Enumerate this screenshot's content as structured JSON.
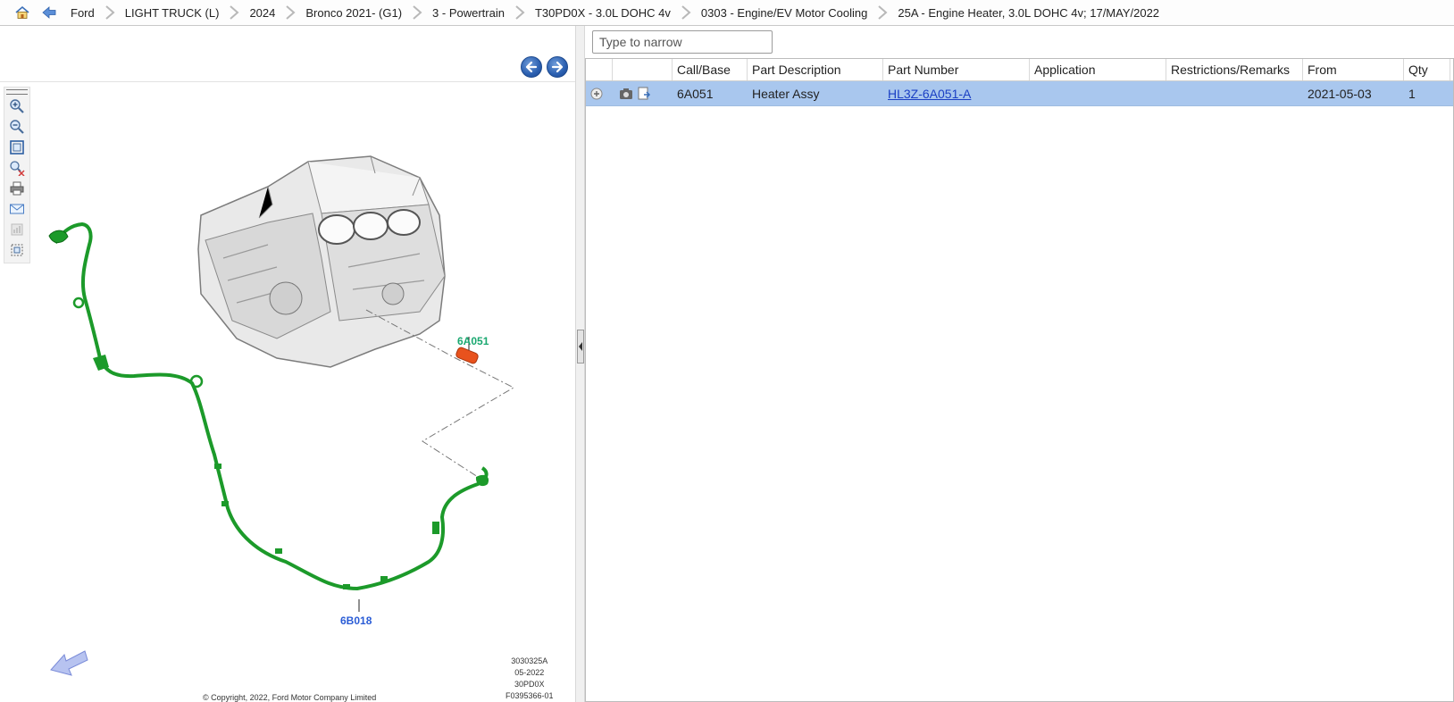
{
  "breadcrumb": [
    "Ford",
    "LIGHT TRUCK (L)",
    "2024",
    "Bronco 2021- (G1)",
    "3 - Powertrain",
    "T30PD0X - 3.0L DOHC 4v",
    "0303 - Engine/EV Motor Cooling",
    "25A - Engine Heater, 3.0L DOHC 4v; 17/MAY/2022"
  ],
  "icons": {
    "home": "home-icon",
    "back": "back-arrow-icon",
    "prev": "previous-arrow-icon",
    "next": "next-arrow-icon",
    "tools": [
      "zoom-in-icon",
      "zoom-out-icon",
      "fit-to-window-icon",
      "clear-zoom-icon",
      "print-icon",
      "email-icon",
      "export-icon",
      "select-region-icon"
    ]
  },
  "diagram": {
    "callouts": [
      "6A051",
      "6B018"
    ],
    "stamp": [
      "3030325A",
      "05-2022",
      "30PD0X",
      "F0395366-01"
    ],
    "copyright": "© Copyright, 2022, Ford Motor Company Limited"
  },
  "filter": {
    "placeholder": "Type to narrow",
    "value": ""
  },
  "grid": {
    "headers": [
      "",
      "",
      "Call/Base",
      "Part Description",
      "Part Number",
      "Application",
      "Restrictions/Remarks",
      "From",
      "Qty"
    ],
    "rows": [
      {
        "call_base": "6A051",
        "description": "Heater Assy",
        "part_number": "HL3Z-6A051-A",
        "application": "",
        "remarks": "",
        "from": "2021-05-03",
        "qty": "1",
        "selected": true
      }
    ]
  },
  "colors": {
    "selected_row": "#a9c7ee",
    "heater_hose": "#1c9a2a",
    "heater_part": "#e8521d",
    "callout_green": "#1aa870",
    "callout_blue": "#2a5cd6"
  }
}
